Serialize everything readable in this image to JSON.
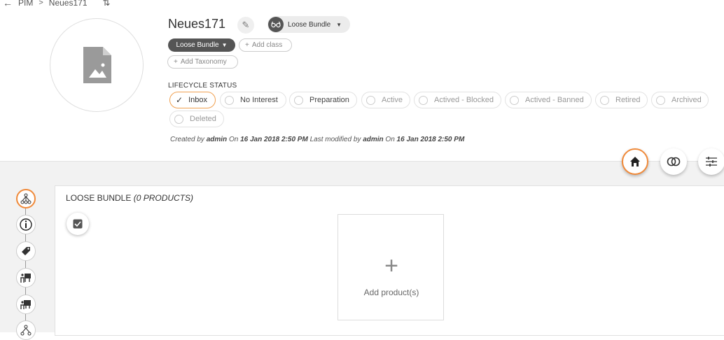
{
  "breadcrumb": {
    "back_icon": "arrow-left-icon",
    "root": "PIM",
    "separator": ">",
    "current": "Neues171",
    "refresh_icon": "refresh-icon"
  },
  "header": {
    "title": "Neues171",
    "edit_icon": "pencil-icon",
    "class_selector": {
      "label": "Loose Bundle",
      "icon": "glasses-icon"
    },
    "class_tag": "Loose Bundle",
    "add_class": "Add class",
    "add_taxonomy": "Add Taxonomy"
  },
  "lifecycle": {
    "label": "LIFECYCLE STATUS",
    "statuses": [
      "Inbox",
      "No Interest",
      "Preparation",
      "Active",
      "Actived - Blocked",
      "Actived - Banned",
      "Retired",
      "Archived",
      "Deleted"
    ],
    "selected": "Inbox"
  },
  "meta": {
    "created_by_label": "Created by",
    "created_by": "admin",
    "on_label": "On",
    "created_on": "16 Jan 2018 2:50 PM",
    "modified_label": "Last modified by",
    "modified_by": "admin",
    "modified_on": "16 Jan 2018 2:50 PM"
  },
  "toolbar": {
    "buttons": [
      "home-icon",
      "rings-icon",
      "list-settings-icon"
    ]
  },
  "side_nav": {
    "icons": [
      "hierarchy-icon",
      "info-icon",
      "tag-icon",
      "presentation-icon",
      "presentation-alt-icon",
      "hierarchy-alt-icon"
    ]
  },
  "bundle_panel": {
    "title": "LOOSE BUNDLE",
    "count": "(0 PRODUCTS)",
    "add_label": "Add product(s)"
  },
  "colors": {
    "accent": "#f08a3a",
    "dark_pill": "#555555"
  }
}
